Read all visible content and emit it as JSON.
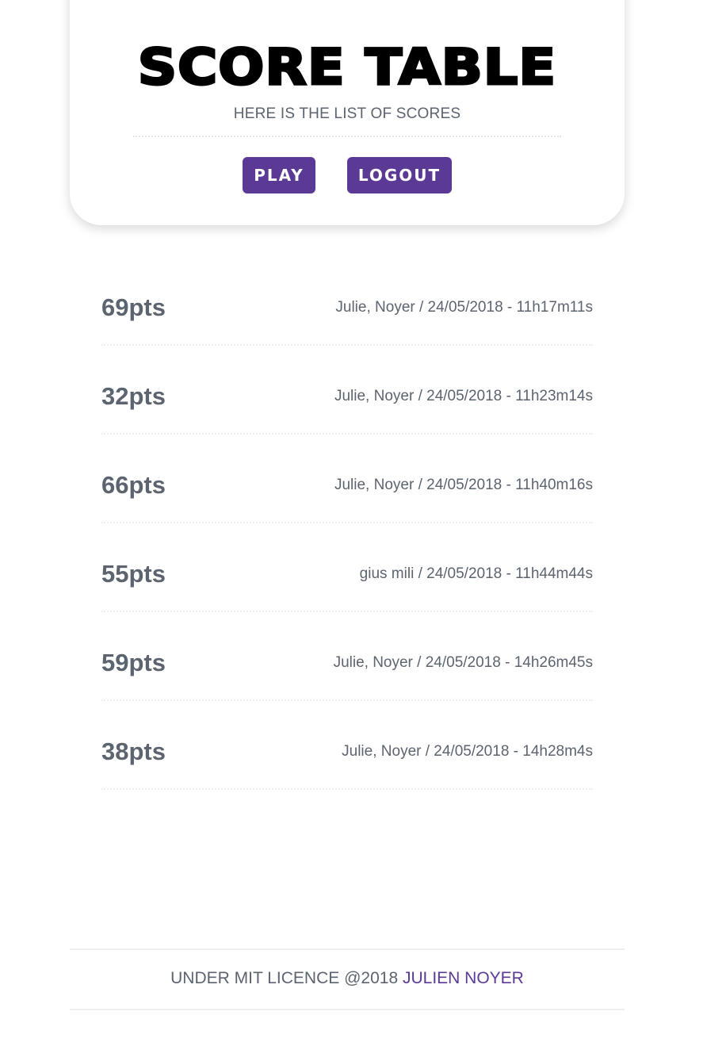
{
  "header": {
    "title": "SCORE TABLE",
    "subtitle": "HERE IS THE LIST OF SCORES",
    "play_label": "PLAY",
    "logout_label": "LOGOUT"
  },
  "scores": [
    {
      "points": "69pts",
      "meta": "Julie, Noyer / 24/05/2018 - 11h17m11s"
    },
    {
      "points": "32pts",
      "meta": "Julie, Noyer / 24/05/2018 - 11h23m14s"
    },
    {
      "points": "66pts",
      "meta": "Julie, Noyer / 24/05/2018 - 11h40m16s"
    },
    {
      "points": "55pts",
      "meta": "gius mili / 24/05/2018 - 11h44m44s"
    },
    {
      "points": "59pts",
      "meta": "Julie, Noyer / 24/05/2018 - 14h26m45s"
    },
    {
      "points": "38pts",
      "meta": "Julie, Noyer / 24/05/2018 - 14h28m4s"
    }
  ],
  "footer": {
    "text": "UNDER MIT LICENCE @2018",
    "link_label": "JULIEN NOYER"
  },
  "colors": {
    "accent": "#5b3a96",
    "text": "#5c6470",
    "title": "#000000"
  }
}
